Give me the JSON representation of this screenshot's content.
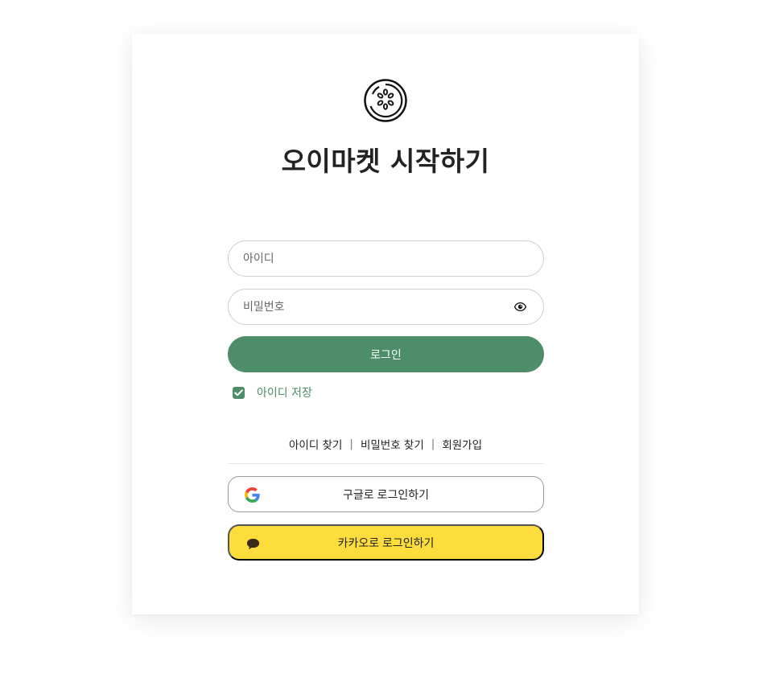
{
  "title": "오이마켓 시작하기",
  "form": {
    "id_placeholder": "아이디",
    "id_value": "",
    "pw_placeholder": "비밀번호",
    "pw_value": "",
    "login_label": "로그인",
    "remember_label": "아이디 저장",
    "remember_checked": true
  },
  "links": {
    "find_id": "아이디 찾기",
    "find_pw": "비밀번호 찾기",
    "signup": "회원가입",
    "separator": "|"
  },
  "social": {
    "google_label": "구글로 로그인하기",
    "kakao_label": "카카오로 로그인하기"
  },
  "icons": {
    "logo": "cucumber-slice-logo",
    "eye": "eye-icon",
    "google": "google-icon",
    "kakao": "speech-bubble-icon"
  },
  "colors": {
    "primary": "#4d8e69",
    "kakao": "#fddd3b",
    "text": "#222222"
  }
}
